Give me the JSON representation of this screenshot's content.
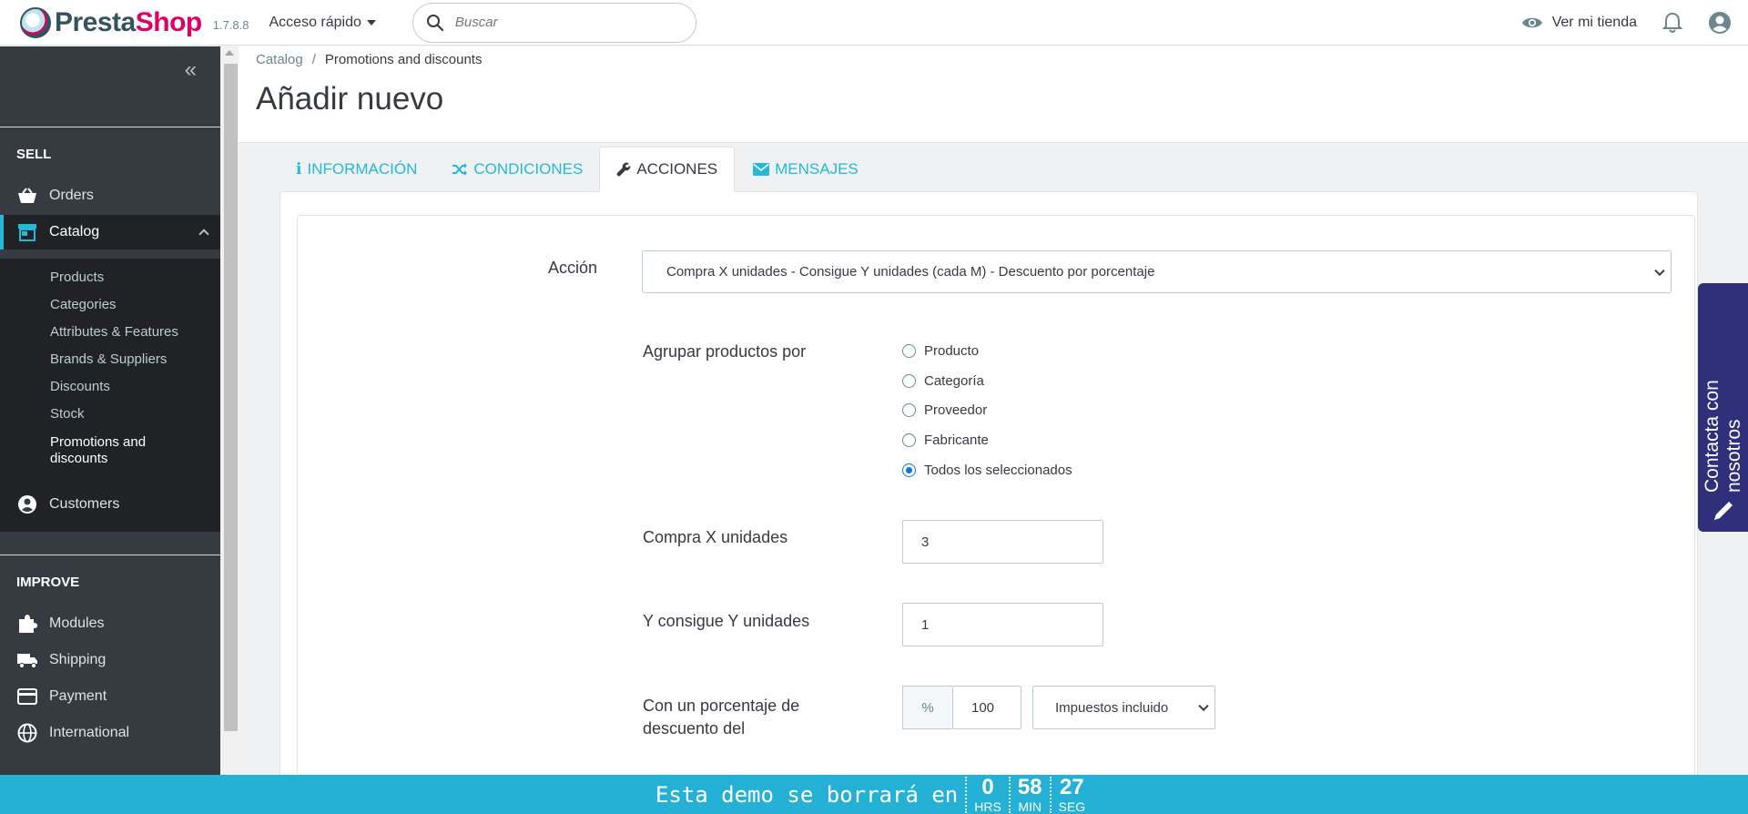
{
  "header": {
    "brand_prefix": "Presta",
    "brand_suffix": "Shop",
    "version": "1.7.8.8",
    "quick_access": "Acceso rápido",
    "search_placeholder": "Buscar",
    "view_shop": "Ver mi tienda",
    "icons": [
      "search-icon",
      "eye-icon",
      "bell-icon",
      "account-icon"
    ]
  },
  "sidebar": {
    "section_sell": "SELL",
    "section_improve": "IMPROVE",
    "items": {
      "orders": "Orders",
      "catalog": "Catalog",
      "customers": "Customers",
      "modules": "Modules",
      "shipping": "Shipping",
      "payment": "Payment",
      "international": "International"
    },
    "catalog_sub": [
      "Products",
      "Categories",
      "Attributes & Features",
      "Brands & Suppliers",
      "Discounts",
      "Stock",
      "Promotions and discounts"
    ]
  },
  "breadcrumb": {
    "parent": "Catalog",
    "separator": "/",
    "current": "Promotions and discounts"
  },
  "page_title": "Añadir nuevo",
  "tabs": [
    "INFORMACIÓN",
    "CONDICIONES",
    "ACCIONES",
    "MENSAJES"
  ],
  "active_tab": "ACCIONES",
  "form": {
    "action_label": "Acción",
    "action_value": "Compra X unidades - Consigue Y unidades (cada M) - Descuento por porcentaje",
    "group_label": "Agrupar productos por",
    "group_options": [
      "Producto",
      "Categoría",
      "Proveedor",
      "Fabricante",
      "Todos los seleccionados"
    ],
    "group_selected": "Todos los seleccionados",
    "buy_x_label": "Compra X unidades",
    "buy_x_value": "3",
    "get_y_label": "Y consigue Y unidades",
    "get_y_value": "1",
    "discount_label_line1": "Con un porcentaje de",
    "discount_label_line2": "descuento del",
    "discount_addon": "%",
    "discount_value": "100",
    "tax_value": "Impuestos incluido"
  },
  "contact": "Contacta con nosotros",
  "banner": {
    "text": "Esta demo se borrará en",
    "hours": "0",
    "hours_unit": "HRS",
    "minutes": "58",
    "minutes_unit": "MIN",
    "seconds": "27",
    "seconds_unit": "SEG"
  },
  "colors": {
    "accent": "#25b9d7",
    "sidebar": "#363a41",
    "sidebar_active": "#202226",
    "brand_pink": "#df0067",
    "contact_bg": "#302f7c",
    "banner_bg": "#25b1d5"
  }
}
